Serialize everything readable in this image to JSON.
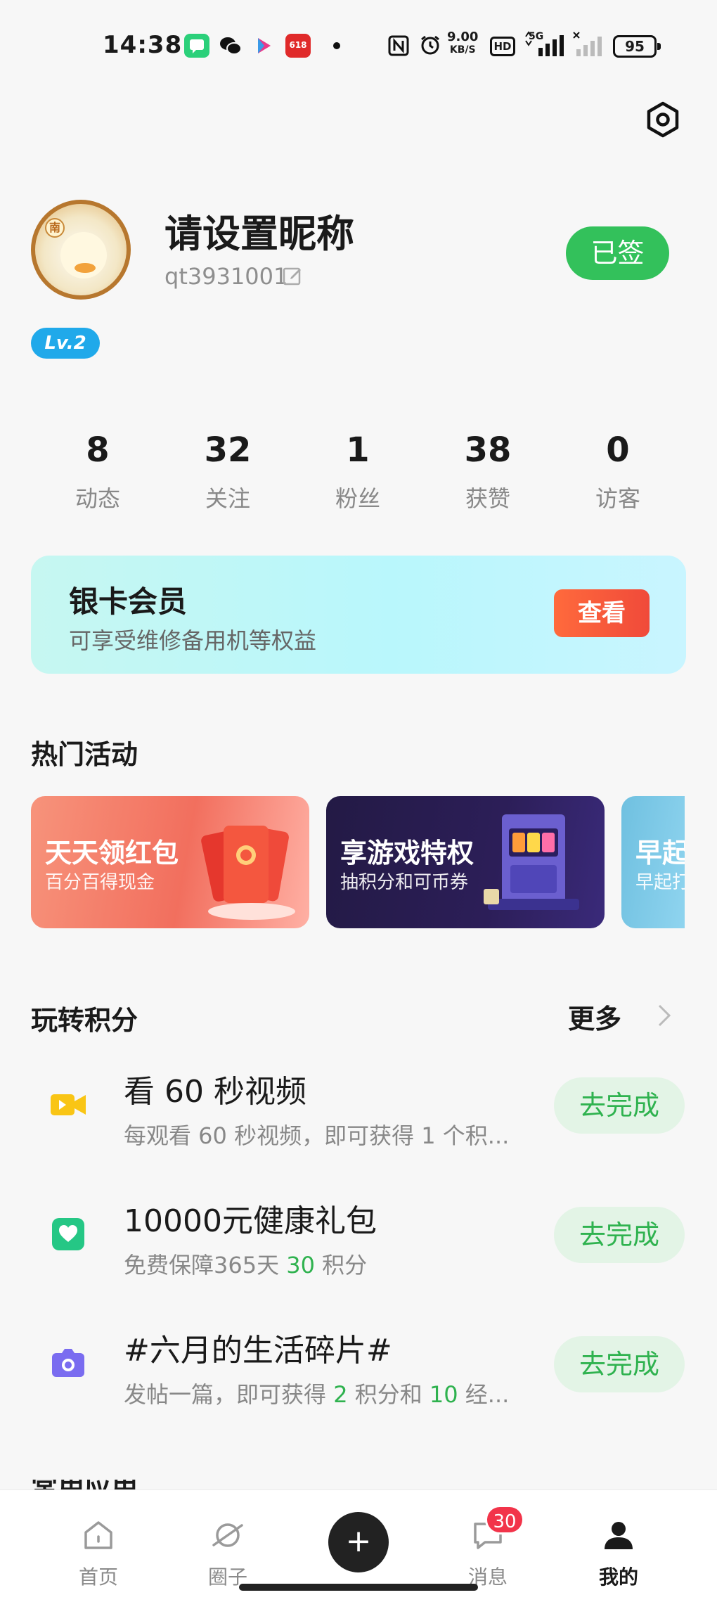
{
  "status_bar": {
    "time": "14:38",
    "net_speed_value": "9.00",
    "net_speed_unit": "KB/S",
    "hd_label": "HD",
    "network_label": "5G",
    "battery": "95",
    "icons": [
      "chat-app-icon",
      "wechat-icon",
      "video-app-icon",
      "618-app-icon",
      "nfc-icon",
      "alarm-icon",
      "signal-icon",
      "no-signal-icon",
      "battery-icon"
    ]
  },
  "profile": {
    "nickname": "请设置昵称",
    "user_id": "qt3931001",
    "signed_label": "已签",
    "level": "Lv.2",
    "avatar_badge": "南"
  },
  "stats": [
    {
      "value": "8",
      "label": "动态"
    },
    {
      "value": "32",
      "label": "关注"
    },
    {
      "value": "1",
      "label": "粉丝"
    },
    {
      "value": "38",
      "label": "获赞"
    },
    {
      "value": "0",
      "label": "访客"
    }
  ],
  "member_card": {
    "title": "银卡会员",
    "subtitle": "可享受维修备用机等权益",
    "button": "查看"
  },
  "activities": {
    "title": "热门活动",
    "items": [
      {
        "title": "天天领红包",
        "subtitle": "百分百得现金"
      },
      {
        "title": "享游戏特权",
        "subtitle": "抽积分和可币券"
      },
      {
        "title": "早起打",
        "subtitle": "早起打卡"
      }
    ]
  },
  "points": {
    "title": "玩转积分",
    "more": "更多",
    "tasks": [
      {
        "title": "看 60 秒视频",
        "desc": "每观看 60 秒视频，即可获得 1 个积...",
        "button": "去完成",
        "icon": "video-camera-icon"
      },
      {
        "title": "10000元健康礼包",
        "desc_before": "免费保障365天 ",
        "desc_highlight": "30",
        "desc_after": " 积分",
        "button": "去完成",
        "icon": "heart-icon"
      },
      {
        "title": "#六月的生活碎片#",
        "desc_before": "发帖一篇，即可获得 ",
        "desc_highlight": "2",
        "desc_middle": " 积分和 ",
        "desc_highlight2": "10",
        "desc_after": " 经...",
        "button": "去完成",
        "icon": "camera-icon"
      }
    ]
  },
  "next_section_title": "常用应用",
  "tabbar": {
    "items": [
      {
        "label": "首页",
        "icon": "home-icon"
      },
      {
        "label": "圈子",
        "icon": "planet-icon"
      },
      {
        "label": "",
        "icon": "plus-icon"
      },
      {
        "label": "消息",
        "icon": "message-icon"
      },
      {
        "label": "我的",
        "icon": "user-icon"
      }
    ],
    "fab_symbol": "+",
    "message_badge": "30"
  },
  "colors": {
    "accent_green": "#33c15b",
    "level_blue": "#20a9ea",
    "member_button": "#f04a3a",
    "badge_red": "#f2344a"
  }
}
